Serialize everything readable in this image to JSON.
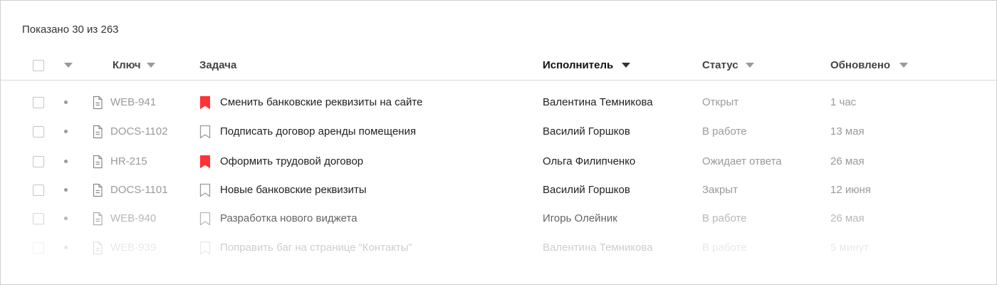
{
  "summary": "Показано 30 из 263",
  "columns": {
    "key": "Ключ",
    "task": "Задача",
    "assignee": "Исполнитель",
    "status": "Статус",
    "updated": "Обновлено"
  },
  "colors": {
    "bookmark_flagged": "#ff3333",
    "bookmark_outline": "#999999",
    "muted_text": "#9a9a9a",
    "divider": "#d9d9d9"
  },
  "rows": [
    {
      "key": "WEB-941",
      "task": "Сменить банковские реквизиты на сайте",
      "flagged": true,
      "assignee": "Валентина Темникова",
      "status": "Открыт",
      "updated": "1 час"
    },
    {
      "key": "DOCS-1102",
      "task": "Подписать договор аренды помещения",
      "flagged": false,
      "assignee": "Василий Горшков",
      "status": "В работе",
      "updated": "13 мая"
    },
    {
      "key": "HR-215",
      "task": "Оформить трудовой договор",
      "flagged": true,
      "assignee": "Ольга Филипченко",
      "status": "Ожидает ответа",
      "updated": "26 мая"
    },
    {
      "key": "DOCS-1101",
      "task": "Новые банковские реквизиты",
      "flagged": false,
      "assignee": "Василий Горшков",
      "status": "Закрыт",
      "updated": "12 июня"
    },
    {
      "key": "WEB-940",
      "task": "Разработка нового виджета",
      "flagged": false,
      "assignee": "Игорь Олейник",
      "status": "В работе",
      "updated": "26 мая"
    },
    {
      "key": "WEB-939",
      "task": "Поправить баг на странице “Контакты”",
      "flagged": false,
      "assignee": "Валентина Темникова",
      "status": "В работе",
      "updated": "5 минут"
    }
  ]
}
